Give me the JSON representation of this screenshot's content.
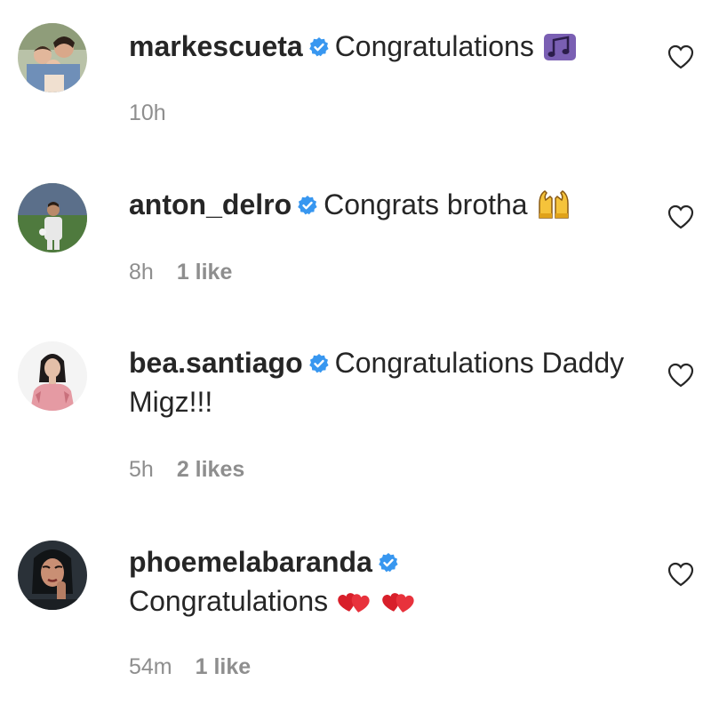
{
  "comments": [
    {
      "username": "markescueta",
      "text": "Congratulations",
      "time": "10h",
      "likes": "",
      "emoji": [
        "music-notes-icon"
      ]
    },
    {
      "username": "anton_delro",
      "text": "Congrats brotha",
      "time": "8h",
      "likes": "1 like",
      "emoji": [
        "raising-hands-icon"
      ]
    },
    {
      "username": "bea.santiago",
      "text": "Congratulations Daddy Migz!!!",
      "time": "5h",
      "likes": "2 likes",
      "emoji": []
    },
    {
      "username": "phoemelabaranda",
      "text": "Congratulations",
      "time": "54m",
      "likes": "1 like",
      "emoji": [
        "two-hearts-icon",
        "two-hearts-icon"
      ]
    }
  ],
  "colors": {
    "text": "#262626",
    "meta": "#8e8e8e",
    "verified": "#3897f0"
  }
}
